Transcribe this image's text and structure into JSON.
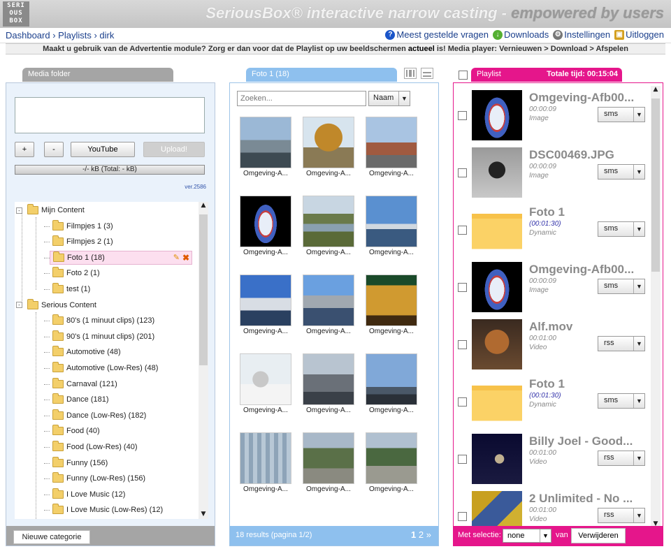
{
  "header": {
    "logo_lines": [
      "SERI",
      "OUS",
      "BOX"
    ],
    "title_main": "SeriousBox® interactive narrow casting - ",
    "title_tag": "empowered by users"
  },
  "breadcrumb": {
    "items": [
      "Dashboard",
      "Playlists",
      "dirk"
    ],
    "sep": " › "
  },
  "toplinks": [
    {
      "label": "Meest gestelde vragen",
      "icon": "question-icon",
      "color": "#1a55c9"
    },
    {
      "label": "Downloads",
      "icon": "download-icon",
      "color": "#55b033"
    },
    {
      "label": "Instellingen",
      "icon": "gear-icon",
      "color": "#777777"
    },
    {
      "label": "Uitloggen",
      "icon": "lock-icon",
      "color": "#d4a020"
    }
  ],
  "notice": {
    "pre": "Maakt u gebruik van de Advertentie module? Zorg er dan voor dat de Playlist op uw beeldschermen ",
    "bold": "actueel",
    "post": " is! Media player: Vernieuwen > Download > Afspelen"
  },
  "left": {
    "tab": "Media folder",
    "buttons": {
      "plus": "+",
      "minus": "-",
      "youtube": "YouTube",
      "upload": "Upload!"
    },
    "size_bar": "-/- kB (Total: - kB)",
    "version": "ver.2586",
    "tree": [
      {
        "label": "Mijn Content",
        "level": 0,
        "expander": "-"
      },
      {
        "label": "Filmpjes 1 (3)",
        "level": 1
      },
      {
        "label": "Filmpjes 2 (1)",
        "level": 1
      },
      {
        "label": "Foto 1 (18)",
        "level": 1,
        "selected": true
      },
      {
        "label": "Foto 2 (1)",
        "level": 1
      },
      {
        "label": "test (1)",
        "level": 1
      },
      {
        "label": "Serious Content",
        "level": 0,
        "expander": "-"
      },
      {
        "label": "80's (1 minuut clips) (123)",
        "level": 1
      },
      {
        "label": "90's (1 minuut clips) (201)",
        "level": 1
      },
      {
        "label": "Automotive (48)",
        "level": 1
      },
      {
        "label": "Automotive (Low-Res) (48)",
        "level": 1
      },
      {
        "label": "Carnaval (121)",
        "level": 1
      },
      {
        "label": "Dance (181)",
        "level": 1
      },
      {
        "label": "Dance (Low-Res) (182)",
        "level": 1
      },
      {
        "label": "Food (40)",
        "level": 1
      },
      {
        "label": "Food (Low-Res) (40)",
        "level": 1
      },
      {
        "label": "Funny (156)",
        "level": 1
      },
      {
        "label": "Funny (Low-Res) (156)",
        "level": 1
      },
      {
        "label": "I Love Music (12)",
        "level": 1
      },
      {
        "label": "I Love Music (Low-Res) (12)",
        "level": 1
      }
    ],
    "new_category": "Nieuwe categorie"
  },
  "middle": {
    "tab": "Foto 1 (18)",
    "search_placeholder": "Zoeken...",
    "sort": "Naam",
    "thumbs": [
      {
        "caption": "Omgeving-A...",
        "scene": "city"
      },
      {
        "caption": "Omgeving-A...",
        "scene": "tree"
      },
      {
        "caption": "Omgeving-A...",
        "scene": "street"
      },
      {
        "caption": "Omgeving-A...",
        "scene": "dome"
      },
      {
        "caption": "Omgeving-A...",
        "scene": "canal"
      },
      {
        "caption": "Omgeving-A...",
        "scene": "lake"
      },
      {
        "caption": "Omgeving-A...",
        "scene": "harbor"
      },
      {
        "caption": "Omgeving-A...",
        "scene": "harbor2"
      },
      {
        "caption": "Omgeving-A...",
        "scene": "office"
      },
      {
        "caption": "Omgeving-A...",
        "scene": "winter"
      },
      {
        "caption": "Omgeving-A...",
        "scene": "city2"
      },
      {
        "caption": "Omgeving-A...",
        "scene": "city3"
      },
      {
        "caption": "Omgeving-A...",
        "scene": "glass"
      },
      {
        "caption": "Omgeving-A...",
        "scene": "aerial"
      },
      {
        "caption": "Omgeving-A...",
        "scene": "aerial2"
      }
    ],
    "results": "18 results (pagina 1/2)",
    "pages": [
      "1",
      "2",
      "»"
    ]
  },
  "right": {
    "tab": "Playlist",
    "total": "Totale tijd: 00:15:04",
    "items": [
      {
        "title": "Omgeving-Afb00...",
        "time": "00:00:09",
        "type": "Image",
        "select": "sms",
        "img": "dome"
      },
      {
        "title": "DSC00469.JPG",
        "time": "00:00:09",
        "type": "Image",
        "select": "sms",
        "img": "moto"
      },
      {
        "title": "Foto 1",
        "time": "(00:01:30)",
        "type": "Dynamic",
        "select": "sms",
        "img": "folder"
      },
      {
        "title": "Omgeving-Afb00...",
        "time": "00:00:09",
        "type": "Image",
        "select": "sms",
        "img": "dome"
      },
      {
        "title": "Alf.mov",
        "time": "00:01:00",
        "type": "Video",
        "select": "rss",
        "img": "alf"
      },
      {
        "title": "Foto 1",
        "time": "(00:01:30)",
        "type": "Dynamic",
        "select": "sms",
        "img": "folder"
      },
      {
        "title": "Billy Joel - Good...",
        "time": "00:01:00",
        "type": "Video",
        "select": "rss",
        "img": "concert"
      },
      {
        "title": "2 Unlimited - No ...",
        "time": "00:01:00",
        "type": "Video",
        "select": "rss",
        "img": "unlimited"
      }
    ],
    "footer": {
      "label": "Met selectie:",
      "select": "none",
      "van": "van",
      "delete": "Verwijderen"
    }
  }
}
